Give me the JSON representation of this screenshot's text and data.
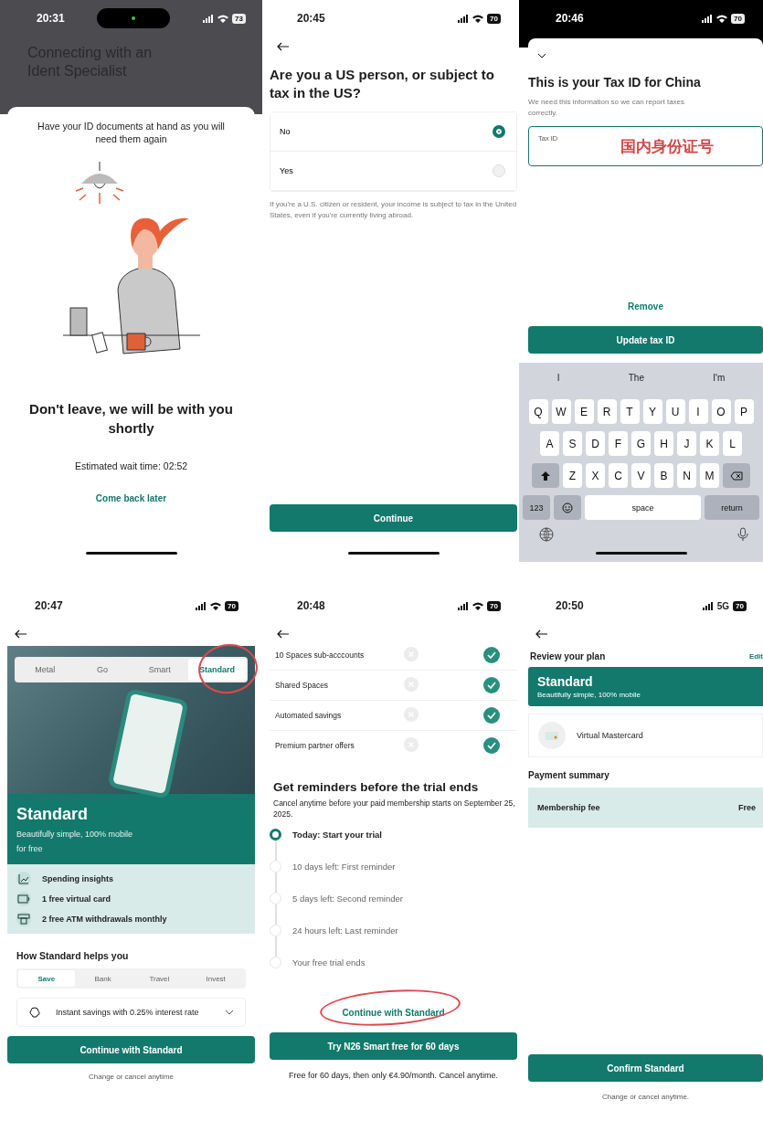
{
  "screens": [
    {
      "kind": "ident",
      "status": {
        "time": "20:31",
        "battery": "73"
      },
      "title": "Connecting with an Ident Specialist",
      "notice": "Have your ID documents at hand as you will need them again",
      "heading": "Don't leave, we will be with you shortly",
      "wait": "Estimated wait time: 02:52",
      "link": "Come back later"
    },
    {
      "kind": "question",
      "status": {
        "time": "20:45",
        "battery": "70"
      },
      "title": "Are you a US person, or subject to tax in the US?",
      "options": [
        {
          "label": "No",
          "selected": true
        },
        {
          "label": "Yes",
          "selected": false
        }
      ],
      "note": "If you're a U.S. citizen or resident, your income is subject to tax in the United States, even if you're currently living abroad.",
      "button": "Continue"
    },
    {
      "kind": "tax_id",
      "status": {
        "time": "20:46",
        "battery": "70"
      },
      "title": "This is your Tax ID for China",
      "subtitle": "We need this information so we can report taxes correctly.",
      "field": {
        "label": "Tax ID",
        "value": "国内身份证号"
      },
      "link": "Remove",
      "button": "Update tax ID",
      "keyboard": {
        "suggestions": [
          "I",
          "The",
          "I'm"
        ],
        "rows": [
          [
            "Q",
            "W",
            "E",
            "R",
            "T",
            "Y",
            "U",
            "I",
            "O",
            "P"
          ],
          [
            "A",
            "S",
            "D",
            "F",
            "G",
            "H",
            "J",
            "K",
            "L"
          ],
          [
            "Z",
            "X",
            "C",
            "V",
            "B",
            "N",
            "M"
          ]
        ],
        "numbers": "123",
        "space": "space",
        "return": "return"
      }
    },
    {
      "kind": "plan",
      "status": {
        "time": "20:47",
        "battery": "70"
      },
      "tabs": [
        {
          "label": "Metal",
          "selected": false,
          "circled": false
        },
        {
          "label": "Go",
          "selected": false,
          "circled": false
        },
        {
          "label": "Smart",
          "selected": false,
          "circled": false
        },
        {
          "label": "Standard",
          "selected": true,
          "circled": true
        }
      ],
      "plan_name": "Standard",
      "tagline": "Beautifully simple, 100% mobile",
      "price": "for free",
      "features": [
        {
          "kind": "chart",
          "label": "Spending insights"
        },
        {
          "kind": "card",
          "label": "1 free virtual card"
        },
        {
          "kind": "atm",
          "label": "2 free ATM withdrawals monthly"
        }
      ],
      "section": "How Standard helps you",
      "subtabs": [
        {
          "label": "Save",
          "selected": true
        },
        {
          "label": "Bank",
          "selected": false
        },
        {
          "label": "Travel",
          "selected": false
        },
        {
          "label": "Invest",
          "selected": false
        }
      ],
      "benefit": "Instant savings with 0.25% interest rate",
      "button": "Continue with Standard",
      "footnote": "Change or cancel anytime"
    },
    {
      "kind": "trial",
      "status": {
        "time": "20:48",
        "battery": "70"
      },
      "comparison": [
        {
          "label": "10 Spaces sub-acccounts",
          "standard": false,
          "smart": true
        },
        {
          "label": "Shared Spaces",
          "standard": false,
          "smart": true
        },
        {
          "label": "Automated savings",
          "standard": false,
          "smart": true
        },
        {
          "label": "Premium partner offers",
          "standard": false,
          "smart": true
        }
      ],
      "title": "Get reminders before the trial ends",
      "subtitle": "Cancel anytime before your paid membership starts on September 25, 2025.",
      "steps": [
        {
          "label": "Today: Start your trial",
          "selected": true
        },
        {
          "label": "10 days left: First reminder",
          "selected": false
        },
        {
          "label": "5 days left: Second reminder",
          "selected": false
        },
        {
          "label": "24 hours left: Last reminder",
          "selected": false
        },
        {
          "label": "Your free trial ends",
          "selected": false
        }
      ],
      "link": {
        "label": "Continue with Standard",
        "circled": true
      },
      "button": "Try N26 Smart free for 60 days",
      "footnote": "Free for 60 days, then only €4.90/month. Cancel anytime."
    },
    {
      "kind": "review",
      "status": {
        "time": "20:50",
        "battery": "70",
        "network": "5G"
      },
      "title": "Review your plan",
      "edit": "Edit",
      "plan_name": "Standard",
      "tagline": "Beautifully simple, 100% mobile",
      "card": "Virtual Mastercard",
      "section": "Payment summary",
      "fee_label": "Membership fee",
      "fee_value": "Free",
      "button": "Confirm Standard",
      "footnote": "Change or cancel anytime."
    }
  ]
}
